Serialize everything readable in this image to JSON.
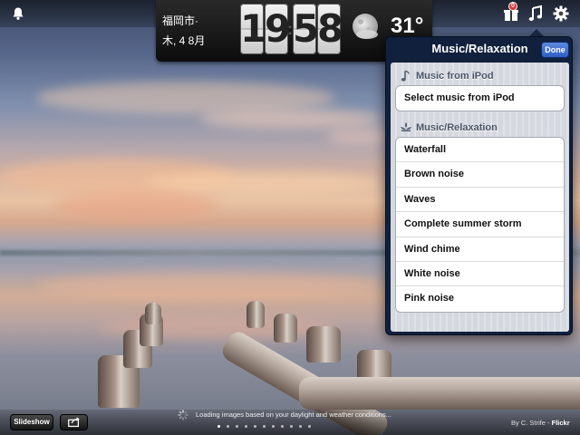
{
  "clock": {
    "city": "福岡市·",
    "date": "木, 4 8月",
    "digits": [
      "1",
      "9",
      "5",
      "8"
    ],
    "separator": ":",
    "temperature": "31°",
    "weather_icon": "moon-cloudy-icon"
  },
  "topbar": {
    "left_icon": "bell-icon",
    "right_icons": [
      "gift-icon",
      "music-note-icon",
      "gear-icon"
    ],
    "badge": "0"
  },
  "popover": {
    "title": "Music/Relaxation",
    "done_label": "Done",
    "sections": [
      {
        "header": "Music from iPod",
        "icon": "music-note-icon",
        "items": [
          "Select music from iPod"
        ]
      },
      {
        "header": "Music/Relaxation",
        "icon": "lotus-icon",
        "items": [
          "Waterfall",
          "Brown noise",
          "Waves",
          "Complete summer storm",
          "Wind chime",
          "White noise",
          "Pink noise"
        ]
      }
    ]
  },
  "bottombar": {
    "slideshow_label": "Slideshow",
    "share_icon": "share-icon",
    "loading_text": "Loading images based on your daylight and weather conditions...",
    "credit_author": "By C. Strife -",
    "credit_source": "Flickr",
    "page_dots_count": 11,
    "active_dot": 0
  }
}
